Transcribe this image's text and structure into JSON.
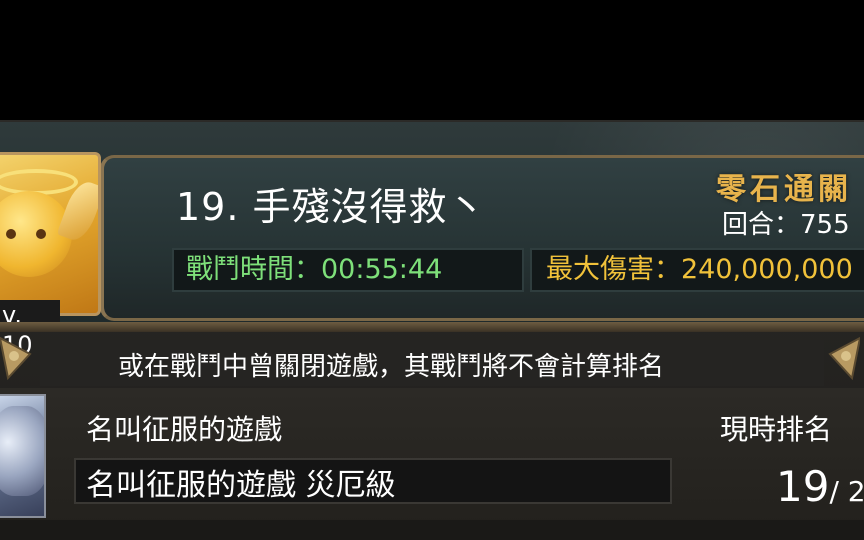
{
  "player": {
    "rank_and_name": "19. 手殘沒得救丶",
    "level": "v. 10"
  },
  "mode": {
    "title": "零石通關",
    "rounds": "回合：755"
  },
  "stats": {
    "battle_time": "戰鬥時間：00:55:44",
    "max_damage": "最大傷害：240,000,000"
  },
  "notice": "或在戰鬥中曾關閉遊戲，其戰鬥將不會計算排名",
  "stage": {
    "name": "名叫征服的遊戲",
    "full_name": "名叫征服的遊戲 災厄級"
  },
  "ranking": {
    "label": "現時排名",
    "value": "19",
    "total": "/ 2"
  },
  "colors": {
    "time_green": "#7ee07a",
    "damage_gold": "#f1c23a",
    "mode_title": "#e8b44c"
  },
  "icons": {
    "player_avatar": "golden-angel-avatar-icon",
    "stage_avatar": "silver-hair-character-icon",
    "ornaments": "gold-scroll-ornament-icon"
  }
}
